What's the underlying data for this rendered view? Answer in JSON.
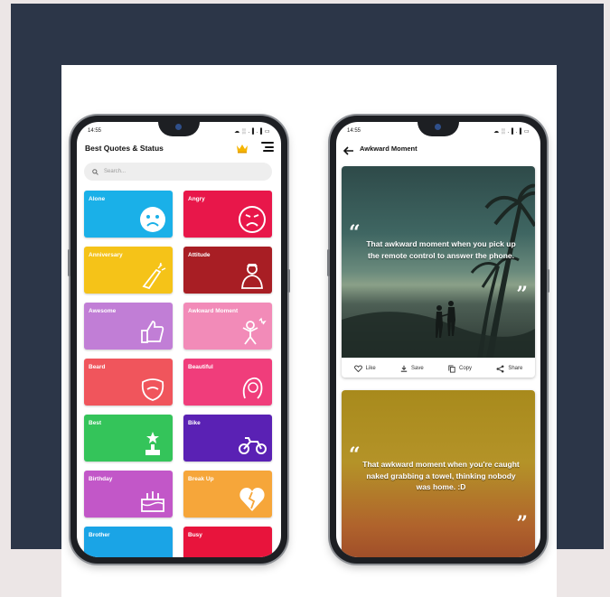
{
  "left_screen": {
    "time": "14:55",
    "status_icons": "☁ ░ .▐ .▐ ▭",
    "title": "Best Quotes & Status",
    "crown_icon": "crown-icon",
    "menu_icon": "menu-icon",
    "search_placeholder": "Search...",
    "categories": [
      {
        "label": "Alone",
        "color": "#1ab0e8",
        "icon": "sad-face-icon"
      },
      {
        "label": "Angry",
        "color": "#e8174a",
        "icon": "angry-face-icon"
      },
      {
        "label": "Anniversary",
        "color": "#f5c318",
        "icon": "champagne-icon"
      },
      {
        "label": "Attitude",
        "color": "#a81e24",
        "icon": "attitude-person-icon"
      },
      {
        "label": "Awesome",
        "color": "#c17ed6",
        "icon": "thumbs-up-icon"
      },
      {
        "label": "Awkward Moment",
        "color": "#f28bb8",
        "icon": "awkward-person-icon"
      },
      {
        "label": "Beard",
        "color": "#f0555c",
        "icon": "beard-icon"
      },
      {
        "label": "Beautiful",
        "color": "#f03d7b",
        "icon": "woman-face-icon"
      },
      {
        "label": "Best",
        "color": "#34c45a",
        "icon": "trophy-icon"
      },
      {
        "label": "Bike",
        "color": "#5a21b4",
        "icon": "motorbike-icon"
      },
      {
        "label": "Birthday",
        "color": "#c257c8",
        "icon": "cake-icon"
      },
      {
        "label": "Break Up",
        "color": "#f6a63a",
        "icon": "broken-heart-icon"
      },
      {
        "label": "Brother",
        "color": "#1aa4e6",
        "icon": ""
      },
      {
        "label": "Busy",
        "color": "#e8143c",
        "icon": ""
      }
    ]
  },
  "right_screen": {
    "time": "14:55",
    "status_icons": "☁ ░ .▐ .▐ ▭",
    "title": "Awkward Moment",
    "back_icon": "back-arrow-icon",
    "post1_quote": "That awkward moment  when you pick up the remote control to answer the phone.",
    "post2_quote": "That awkward moment  when you're caught naked grabbing a towel, thinking nobody was home. :D",
    "open_quote": "“",
    "close_quote": "”",
    "actions": {
      "like": "Like",
      "save": "Save",
      "copy": "Copy",
      "share": "Share"
    }
  }
}
